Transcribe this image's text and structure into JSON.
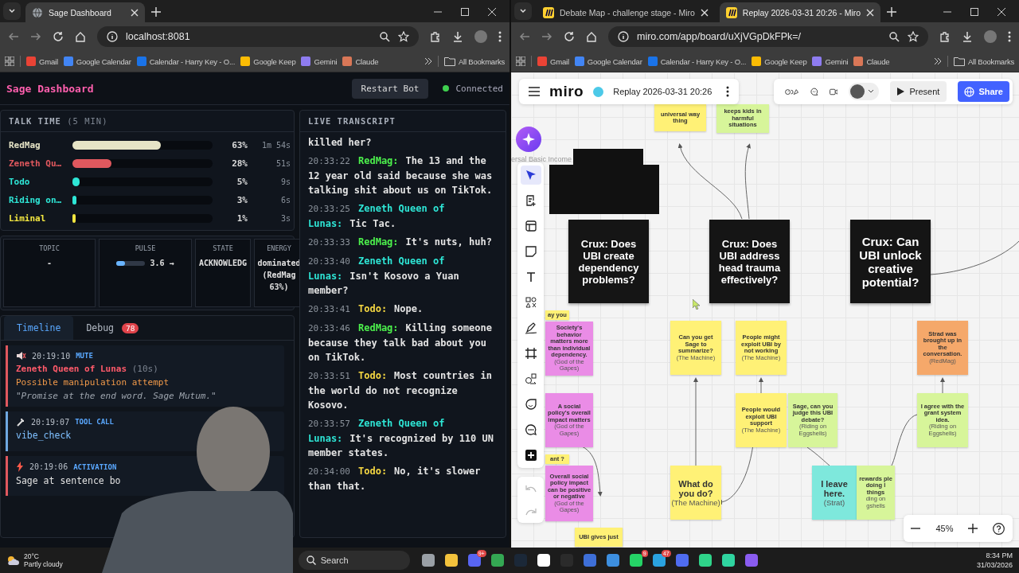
{
  "browsers": [
    {
      "tabs": [
        {
          "title": "Sage Dashboard",
          "selected": true,
          "kind": "globe"
        }
      ],
      "url": "localhost:8081",
      "bookmarks": [
        "Gmail",
        "Google Calendar",
        "Calendar - Harry Key - O...",
        "Google Keep",
        "Gemini",
        "Claude"
      ],
      "all_bookmarks": "All Bookmarks"
    },
    {
      "tabs": [
        {
          "title": "Debate Map - challenge stage - Miro",
          "selected": false,
          "kind": "miro"
        },
        {
          "title": "Replay 2026-03-31 20:26 - Miro",
          "selected": true,
          "kind": "miro"
        }
      ],
      "url": "miro.com/app/board/uXjVGpDkFPk=/",
      "bookmarks": [
        "Gmail",
        "Google Calendar",
        "Calendar - Harry Key - O...",
        "Google Keep",
        "Gemini",
        "Claude"
      ],
      "all_bookmarks": "All Bookmarks"
    }
  ],
  "dashboard": {
    "title": "Sage Dashboard",
    "restart_button": "Restart Bot",
    "status": {
      "label": "Connected",
      "connected": true
    },
    "talk_time": {
      "title": "TALK TIME",
      "window": "(5 MIN)",
      "rows": [
        {
          "name": "RedMag",
          "color": "#e6e4c6",
          "level": 0.63,
          "percent": "63%",
          "duration": "1m 54s"
        },
        {
          "name": "Zeneth Qu…",
          "color": "#e0585e",
          "level": 0.28,
          "percent": "28%",
          "duration": "51s"
        },
        {
          "name": "Todo",
          "color": "#2ee6d6",
          "level": 0.05,
          "percent": "5%",
          "duration": "9s"
        },
        {
          "name": "Riding on…",
          "color": "#2ee6d6",
          "level": 0.03,
          "percent": "3%",
          "duration": "6s"
        },
        {
          "name": "Liminal",
          "color": "#f2e640",
          "level": 0.01,
          "percent": "1%",
          "duration": "3s"
        }
      ]
    },
    "stats": [
      {
        "kind": "text",
        "label": "TOPIC",
        "value": "-"
      },
      {
        "kind": "meter",
        "label": "PULSE",
        "level": 0.3,
        "value": "3.6 →"
      },
      {
        "kind": "text",
        "label": "STATE",
        "value": "ACKNOWLEDG"
      },
      {
        "kind": "text",
        "label": "ENERGY",
        "value": "dominated (RedMag 63%)"
      }
    ],
    "tabs": [
      {
        "label": "Timeline",
        "selected": true
      },
      {
        "label": "Debug",
        "selected": false,
        "badge": "78"
      }
    ],
    "timeline": [
      {
        "kind": "mute",
        "time": "20:19:10",
        "type": "MUTE",
        "color": "#e0585e",
        "speaker": "Zeneth Queen of Lunas",
        "duration": "(10s)",
        "reason": "Possible manipulation attempt",
        "quote": "\"Promise at the end word. Sage Mutum.\""
      },
      {
        "kind": "tool_call",
        "time": "20:19:07",
        "type": "TOOL CALL",
        "color": "#6fa8e0",
        "detail": "vibe_check"
      },
      {
        "kind": "activation",
        "time": "20:19:06",
        "type": "ACTIVATION",
        "color": "#e0585e",
        "detail": "Sage at sentence bo"
      }
    ],
    "transcript": {
      "title": "LIVE TRANSCRIPT",
      "entries": [
        {
          "text": "killed her?"
        },
        {
          "time": "20:33:22",
          "speaker": "RedMag:",
          "color": "#4cf04c",
          "text": "The 13 and the 12 year old said because she was talking shit about us on TikTok."
        },
        {
          "time": "20:33:25",
          "speaker": "Zeneth Queen of Lunas:",
          "color": "#2ee6d6",
          "text": "Tic Tac."
        },
        {
          "time": "20:33:33",
          "speaker": "RedMag:",
          "color": "#4cf04c",
          "text": "It's nuts, huh?"
        },
        {
          "time": "20:33:40",
          "speaker": "Zeneth Queen of Lunas:",
          "color": "#2ee6d6",
          "text": "Isn't Kosovo a Yuan member?"
        },
        {
          "time": "20:33:41",
          "speaker": "Todo:",
          "color": "#f5d742",
          "text": "Nope."
        },
        {
          "time": "20:33:46",
          "speaker": "RedMag:",
          "color": "#4cf04c",
          "text": "Killing someone because they talk bad about you on TikTok."
        },
        {
          "time": "20:33:51",
          "speaker": "Todo:",
          "color": "#f5d742",
          "text": "Most countries in the world do not recognize Kosovo."
        },
        {
          "time": "20:33:57",
          "speaker": "Zeneth Queen of Lunas:",
          "color": "#2ee6d6",
          "text": "It's recognized by 110 UN member states."
        },
        {
          "time": "20:34:00",
          "speaker": "Todo:",
          "color": "#f5d742",
          "text": "No, it's slower than that."
        }
      ]
    }
  },
  "miro": {
    "logo": "miro",
    "board_title": "Replay 2026-03-31 20:26",
    "present": "Present",
    "share": "Share",
    "frame_label": "ersal Basic Income",
    "zoom": "45%",
    "tools": [
      {
        "kind": "select",
        "selected": true
      },
      {
        "kind": "note-add",
        "selected": false
      },
      {
        "kind": "template",
        "selected": false
      },
      {
        "kind": "sticky",
        "selected": false
      },
      {
        "kind": "text",
        "selected": false
      },
      {
        "kind": "shapes",
        "selected": false
      },
      {
        "kind": "pen",
        "selected": false
      },
      {
        "kind": "frame",
        "selected": false
      },
      {
        "kind": "connect",
        "selected": false
      },
      {
        "kind": "sticker",
        "selected": false
      },
      {
        "kind": "comment",
        "selected": false
      },
      {
        "kind": "more",
        "selected": false
      }
    ],
    "cruxes": [
      "Crux: Does UBI create dependency problems?",
      "Crux: Does UBI address head trauma effectively?",
      "Crux: Can UBI unlock creative potential?"
    ],
    "stickies": [
      {
        "kind": "note",
        "color": "#fff176",
        "text": "universal way thing"
      },
      {
        "kind": "note",
        "color": "#d7f59a",
        "text": "keeps kids in harmful situations"
      },
      {
        "kind": "note",
        "color": "#fff176",
        "text": "ay you"
      },
      {
        "kind": "note",
        "color": "#ea8ce6",
        "text": "Society's behavior matters more than individual dependency.",
        "author": "(God of the Gapes)"
      },
      {
        "kind": "note",
        "color": "#fff176",
        "text": "Can you get Sage to summarize?",
        "author": "(The Machine)"
      },
      {
        "kind": "note",
        "color": "#fff176",
        "text": "People might exploit UBI by not working",
        "author": "(The Machine)"
      },
      {
        "kind": "note",
        "color": "#f5a86a",
        "text": "Strad was brought up in the conversation.",
        "author": "(RedMag)"
      },
      {
        "kind": "note",
        "color": "#ea8ce6",
        "text": "A social policy's overall impact matters",
        "author": "(God of the Gapes)"
      },
      {
        "kind": "note",
        "color": "#fff176",
        "text": "People would exploit UBI support",
        "author": "(The Machine)"
      },
      {
        "kind": "note",
        "color": "#d7f59a",
        "text": "Sage, can you judge this UBI debate?",
        "author": "(Riding on Eggshells)"
      },
      {
        "kind": "note",
        "color": "#d7f59a",
        "text": "I agree with the grant system idea.",
        "author": "(Riding on Eggshells)"
      },
      {
        "kind": "note",
        "color": "#fff176",
        "text": "ant ?"
      },
      {
        "kind": "note",
        "color": "#ea8ce6",
        "text": "Overall social policy impact can be positive or negative",
        "author": "(God of the Gapes)"
      },
      {
        "kind": "big",
        "color": "#fff176",
        "text": "What do you do?",
        "author": "(The Machine)"
      },
      {
        "kind": "big",
        "color": "#7ee8dc",
        "text": "I leave here.",
        "author": "(Strat)"
      },
      {
        "kind": "note",
        "color": "#d7f59a",
        "text": "rewards ple doing l things",
        "author": "ding on gshells"
      },
      {
        "kind": "note",
        "color": "#fff176",
        "text": "UBI gives just"
      }
    ]
  },
  "taskbar": {
    "weather": {
      "temp": "20°C",
      "condition": "Partly cloudy"
    },
    "search": {
      "placeholder": "Search"
    },
    "apps": [
      {
        "kind": "taskview"
      },
      {
        "kind": "folder"
      },
      {
        "kind": "chat",
        "badge": "9+"
      },
      {
        "kind": "browser"
      },
      {
        "kind": "game"
      },
      {
        "kind": "assistant"
      },
      {
        "kind": "terminal"
      },
      {
        "kind": "shell"
      },
      {
        "kind": "notes"
      },
      {
        "kind": "phone",
        "badge": "9"
      },
      {
        "kind": "messenger",
        "badge": "47"
      },
      {
        "kind": "bubble"
      },
      {
        "kind": "tablet"
      },
      {
        "kind": "ring"
      },
      {
        "kind": "feather"
      }
    ],
    "clock": {
      "time": "8:34 PM",
      "date": "31/03/2026"
    }
  }
}
